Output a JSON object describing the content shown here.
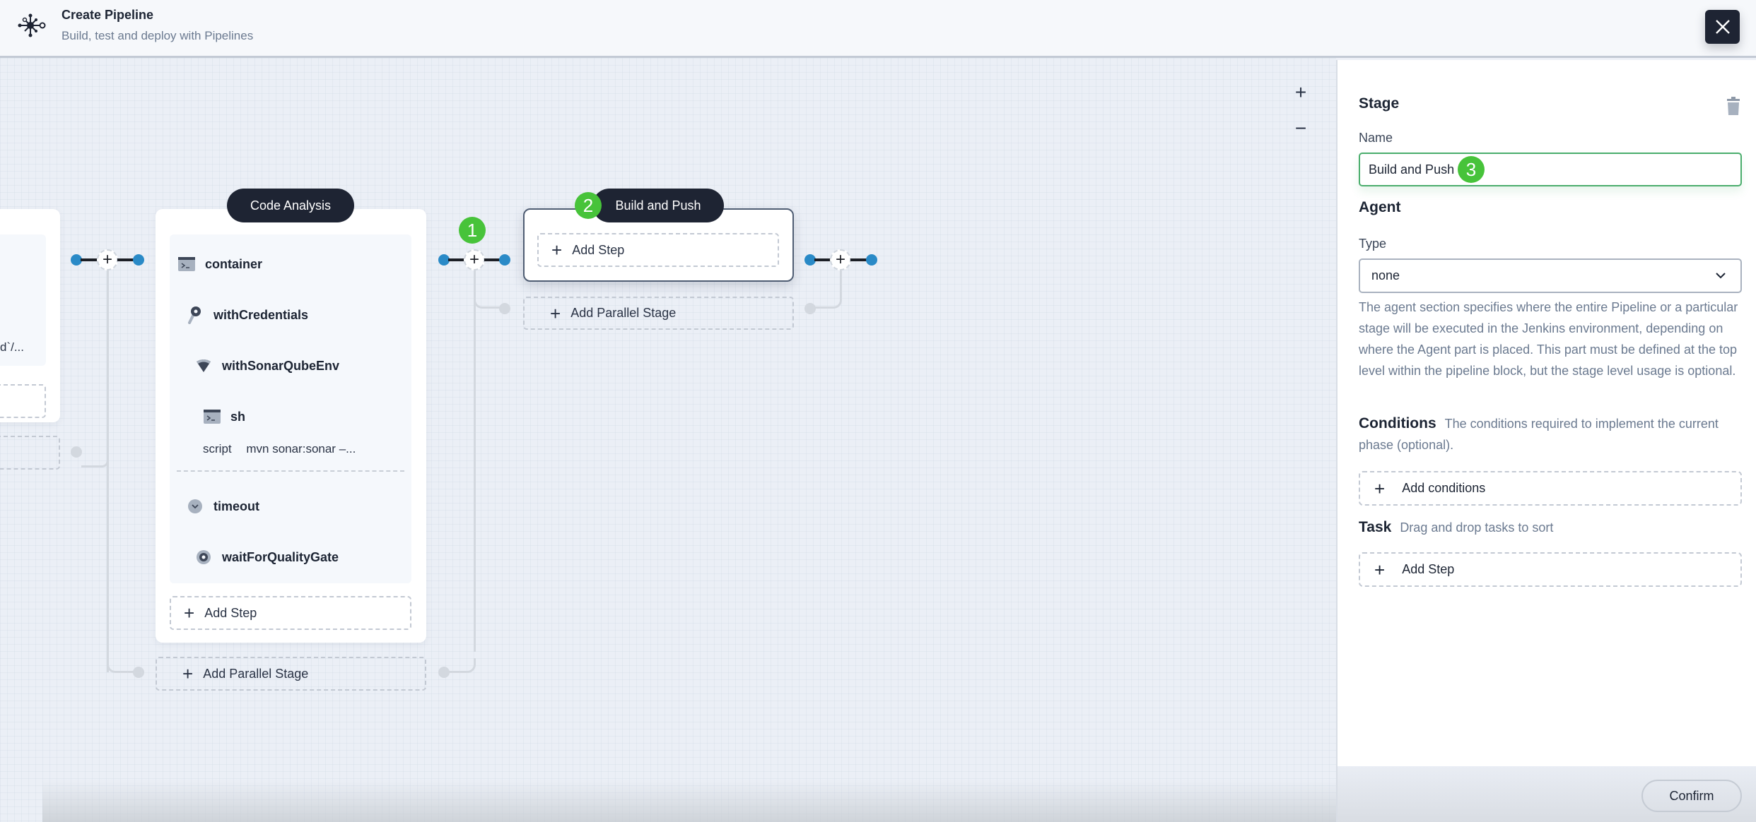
{
  "header": {
    "title": "Create Pipeline",
    "subtitle": "Build, test and deploy with Pipelines",
    "logo_icon": "pipeline-network-icon",
    "close_icon": "close-icon"
  },
  "canvas": {
    "zoom_in_label": "+",
    "zoom_out_label": "−",
    "left_stage": {
      "step_text_truncated": "d`/..."
    },
    "stages": [
      {
        "name": "Code Analysis",
        "steps": [
          {
            "name": "container",
            "icon": "terminal-icon"
          },
          {
            "name": "withCredentials",
            "icon": "key-icon"
          },
          {
            "name": "withSonarQubeEnv",
            "icon": "sonarqube-icon"
          },
          {
            "name": "sh",
            "icon": "terminal-icon",
            "param_key": "script",
            "param_value": "mvn sonar:sonar –..."
          },
          {
            "name": "timeout",
            "icon": "timeout-icon"
          },
          {
            "name": "waitForQualityGate",
            "icon": "quality-gate-icon"
          }
        ],
        "add_step_label": "Add Step",
        "add_parallel_label": "Add Parallel Stage"
      },
      {
        "name": "Build and Push",
        "selected": true,
        "steps": [],
        "add_step_label": "Add Step",
        "add_parallel_label": "Add Parallel Stage"
      }
    ],
    "plus_label": "+",
    "badges": [
      "1",
      "2",
      "3"
    ],
    "badge_color": "#47c33a"
  },
  "panel": {
    "title": "Stage",
    "name_label": "Name",
    "name_value": "Build and Push",
    "agent_heading": "Agent",
    "type_label": "Type",
    "type_value": "none",
    "agent_description": "The agent section specifies where the entire Pipeline or a particular stage will be executed in the Jenkins environment, depending on where the Agent part is placed. This part must be defined at the top level within the pipeline block, but the stage level usage is optional.",
    "conditions_heading": "Conditions",
    "conditions_description": "The conditions required to implement the current phase (optional).",
    "add_conditions_label": "Add conditions",
    "task_heading": "Task",
    "task_description": "Drag and drop tasks to sort",
    "add_step_label": "Add Step",
    "confirm_label": "Confirm"
  },
  "colors": {
    "accent_dark": "#1e2433",
    "connector_blue": "#2a8ac7",
    "input_focus_green": "#4aad6c"
  }
}
